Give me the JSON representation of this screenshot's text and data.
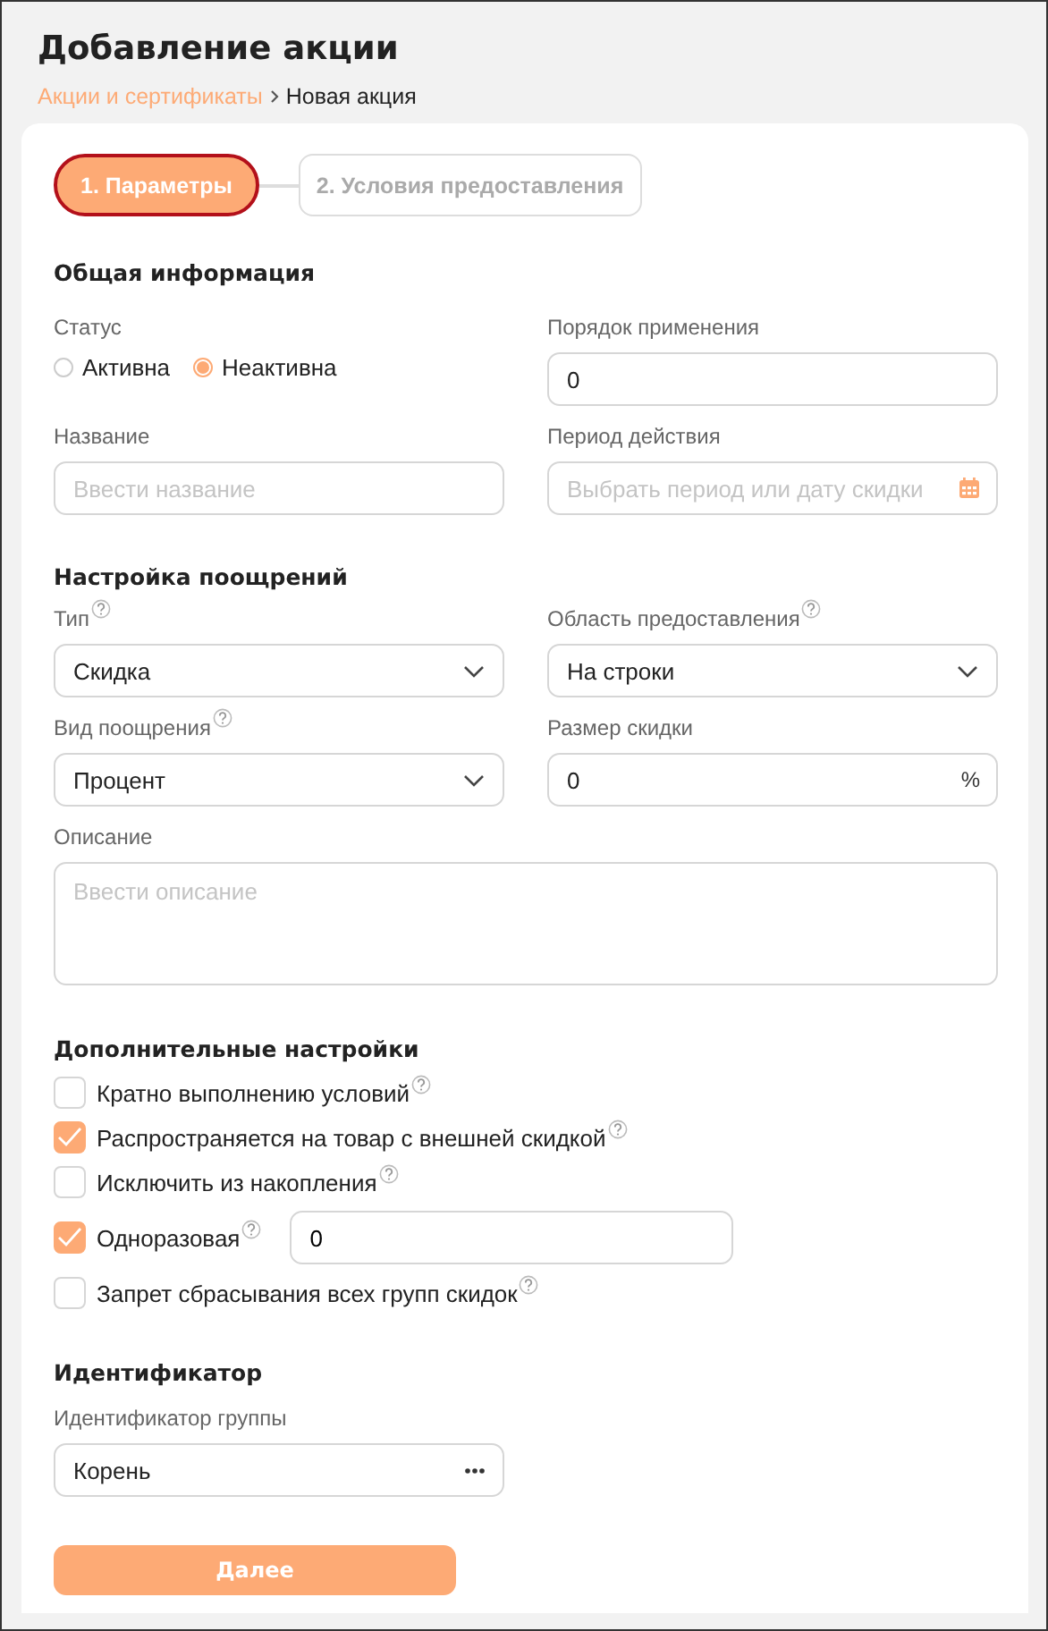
{
  "title": "Добавление акции",
  "breadcrumb": [
    {
      "label": "Акции и сертификаты",
      "kind": "link"
    },
    {
      "label": "Новая акция",
      "kind": "current"
    }
  ],
  "steps": [
    {
      "label": "1. Параметры",
      "selected": true
    },
    {
      "label": "2. Условия предоставления",
      "selected": false
    }
  ],
  "general": {
    "heading": "Общая информация",
    "status": {
      "label": "Статус",
      "options": [
        {
          "label": "Активна",
          "selected": false
        },
        {
          "label": "Неактивна",
          "selected": true
        }
      ]
    },
    "fields": [
      {
        "kind": "text",
        "label": "Порядок применения",
        "value": "0"
      },
      {
        "kind": "text",
        "label": "Название",
        "placeholder": "Ввести название"
      },
      {
        "kind": "date",
        "label": "Период действия",
        "placeholder": "Выбрать период или дату скидки"
      }
    ]
  },
  "rewards": {
    "heading": "Настройка поощрений",
    "fields": [
      {
        "kind": "select",
        "label": "Тип",
        "value": "Скидка",
        "help": true
      },
      {
        "kind": "select",
        "label": "Область предоставления",
        "value": "На строки",
        "help": true
      },
      {
        "kind": "select",
        "label": "Вид поощрения",
        "value": "Процент",
        "help": true
      },
      {
        "kind": "unit",
        "label": "Размер скидки",
        "value": "0",
        "unit": "%"
      },
      {
        "kind": "textarea",
        "label": "Описание",
        "placeholder": "Ввести описание"
      }
    ]
  },
  "extra": {
    "heading": "Дополнительные настройки",
    "options": [
      {
        "label": "Кратно выполнению условий",
        "checked": false,
        "help": true
      },
      {
        "label": "Распространяется на товар с внешней скидкой",
        "checked": true,
        "help": true
      },
      {
        "label": "Исключить из накопления",
        "checked": false,
        "help": true
      },
      {
        "label": "Одноразовая",
        "checked": true,
        "help": true,
        "value": "0"
      },
      {
        "label": "Запрет сбрасывания всех групп скидок",
        "checked": false,
        "help": true
      }
    ]
  },
  "identifier": {
    "heading": "Идентификатор",
    "fields": [
      {
        "kind": "picker",
        "label": "Идентификатор группы",
        "value": "Корень"
      }
    ]
  },
  "next_button": "Далее"
}
